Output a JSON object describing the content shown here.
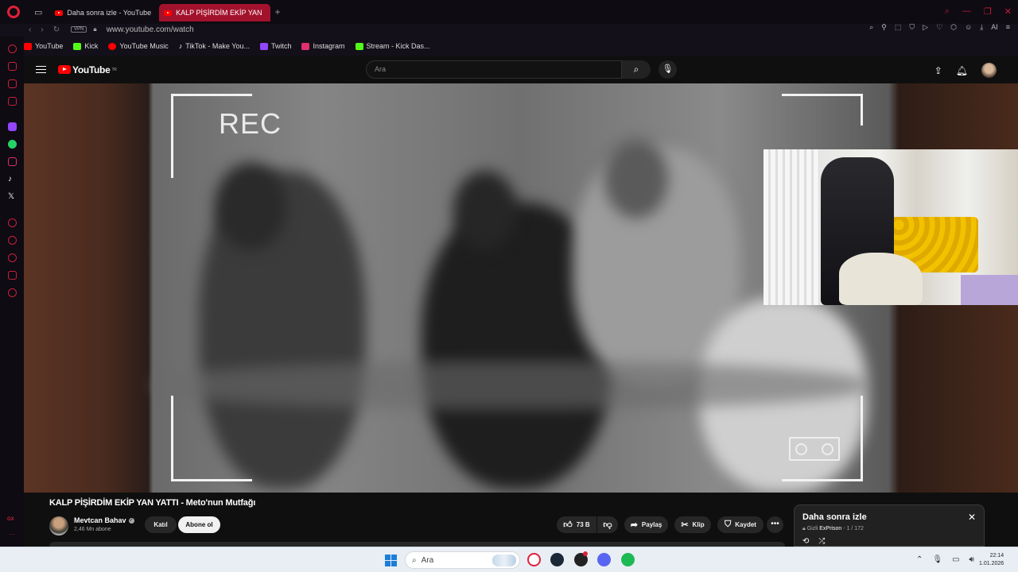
{
  "browser": {
    "tabs": [
      {
        "label": "Daha sonra izle - YouTube",
        "active": false
      },
      {
        "label": "KALP PİŞİRDİM EKİP YAN",
        "active": true
      }
    ],
    "vpn_label": "VPN",
    "url": "www.youtube.com/watch",
    "ai_label": "AI",
    "bookmarks": [
      {
        "label": "YouTube",
        "color": "#ff0000"
      },
      {
        "label": "Kick",
        "color": "#53fc18"
      },
      {
        "label": "YouTube Music",
        "color": "#ff0000"
      },
      {
        "label": "TikTok - Make You...",
        "color": "#ffffff"
      },
      {
        "label": "Twitch",
        "color": "#9146ff"
      },
      {
        "label": "Instagram",
        "color": "#e1306c"
      },
      {
        "label": "Stream - Kick Das...",
        "color": "#53fc18"
      }
    ],
    "sidebar_bottom_label": "GX"
  },
  "youtube": {
    "logo_text": "YouTube",
    "region": "TR",
    "search_placeholder": "Ara",
    "video": {
      "overlay_text": "REC",
      "title": "KALP PİŞİRDİM EKİP YAN YATTI - Meto'nun Mutfağı",
      "channel": "Mevtcan Bahav",
      "subscribers": "2,46 Mn abone",
      "join_label": "Katıl",
      "subscribe_label": "Abone ol",
      "likes": "73 B",
      "share_label": "Paylaş",
      "clip_label": "Klip",
      "save_label": "Kaydet"
    },
    "playlist": {
      "title": "Daha sonra izle",
      "privacy": "Gizli",
      "owner": "ExPrison",
      "position": "1 / 172"
    }
  },
  "taskbar": {
    "search_placeholder": "Ara",
    "time": "22:14",
    "date": "1.01.2026"
  },
  "colors": {
    "accent": "#c8213c",
    "youtube_red": "#ff0000"
  }
}
